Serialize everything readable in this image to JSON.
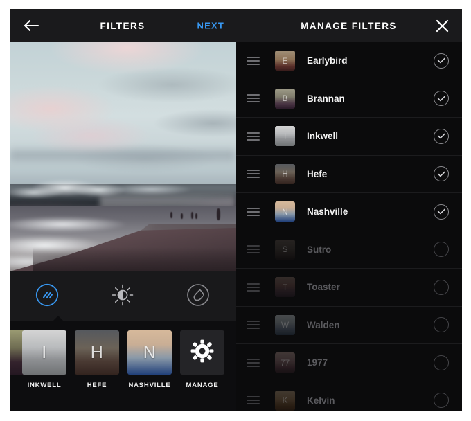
{
  "editor": {
    "nav": {
      "back_icon": "arrow-left-icon",
      "title": "FILTERS",
      "next_label": "NEXT"
    },
    "photo": {
      "alt": "beach-at-dusk-photo"
    },
    "tool_tabs": [
      {
        "name": "filter",
        "icon": "filter-circle-icon",
        "active": true
      },
      {
        "name": "edit",
        "icon": "brightness-sun-icon",
        "active": false
      },
      {
        "name": "blur",
        "icon": "tilt-shift-blur-icon",
        "active": false
      }
    ],
    "carousel": [
      {
        "label": "",
        "letter": "",
        "swatch": "tx-prev",
        "partial": true
      },
      {
        "label": "INKWELL",
        "letter": "I",
        "swatch": "tx-inkwell",
        "partial": false
      },
      {
        "label": "HEFE",
        "letter": "H",
        "swatch": "tx-hefe",
        "partial": false
      },
      {
        "label": "NASHVILLE",
        "letter": "N",
        "swatch": "tx-nashville",
        "partial": false
      },
      {
        "label": "MANAGE",
        "letter": "",
        "swatch": "manage",
        "icon": "gear-icon",
        "partial": false
      }
    ]
  },
  "manage": {
    "nav": {
      "title": "MANAGE FILTERS",
      "close_icon": "close-x-icon"
    },
    "rows": [
      {
        "name": "Earlybird",
        "letter": "E",
        "swatch": "tx-earlybird",
        "enabled": true
      },
      {
        "name": "Brannan",
        "letter": "B",
        "swatch": "tx-brannan",
        "enabled": true
      },
      {
        "name": "Inkwell",
        "letter": "I",
        "swatch": "tx-inkwell",
        "enabled": true
      },
      {
        "name": "Hefe",
        "letter": "H",
        "swatch": "tx-hefe",
        "enabled": true
      },
      {
        "name": "Nashville",
        "letter": "N",
        "swatch": "tx-nashville",
        "enabled": true
      },
      {
        "name": "Sutro",
        "letter": "S",
        "swatch": "tx-sutro",
        "enabled": false
      },
      {
        "name": "Toaster",
        "letter": "T",
        "swatch": "tx-toaster",
        "enabled": false
      },
      {
        "name": "Walden",
        "letter": "W",
        "swatch": "tx-walden",
        "enabled": false
      },
      {
        "name": "1977",
        "letter": "77",
        "swatch": "tx-1977",
        "enabled": false
      },
      {
        "name": "Kelvin",
        "letter": "K",
        "swatch": "tx-kelvin",
        "enabled": false
      }
    ]
  },
  "colors": {
    "accent_blue": "#3897f0",
    "nav_background": "#1a1a1c",
    "panel_background": "#0d0d0f",
    "list_background": "#0b0b0c",
    "page_background": "#ffffff"
  }
}
